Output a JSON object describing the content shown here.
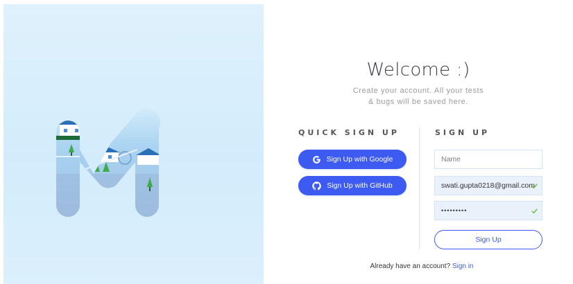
{
  "welcome": {
    "title": "Welcome :)",
    "subtitle_line1": "Create your account. All your tests",
    "subtitle_line2": "& bugs will be saved here."
  },
  "quick_signup": {
    "title": "QUICK SIGN UP",
    "google_label": "Sign Up with Google",
    "github_label": "Sign Up with GitHub"
  },
  "signup": {
    "title": "SIGN UP",
    "name_placeholder": "Name",
    "email_value": "swati.gupta0218@gmail.com",
    "password_value": "•••••••••",
    "submit_label": "Sign Up"
  },
  "footer": {
    "prompt": "Already have an account?",
    "signin_link": "Sign in"
  },
  "colors": {
    "accent": "#3d5af1",
    "panel_bg": "#d8eefb",
    "valid_check": "#6abf3a"
  },
  "icons": {
    "google": "google-icon",
    "github": "github-icon",
    "valid": "check-icon"
  }
}
